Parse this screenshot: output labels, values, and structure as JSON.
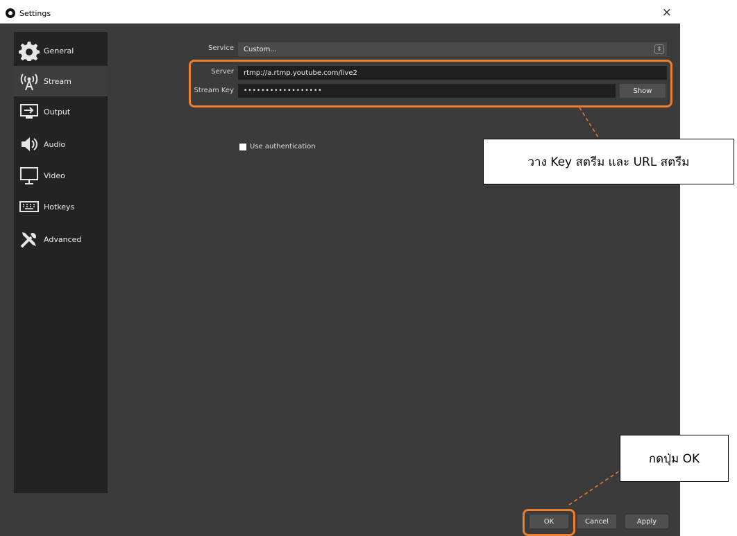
{
  "window": {
    "title": "Settings",
    "close_glyph": "×"
  },
  "sidebar": {
    "items": [
      {
        "label": "General",
        "icon": "gear-icon"
      },
      {
        "label": "Stream",
        "icon": "antenna-icon",
        "active": true
      },
      {
        "label": "Output",
        "icon": "output-icon"
      },
      {
        "label": "Audio",
        "icon": "speaker-icon"
      },
      {
        "label": "Video",
        "icon": "monitor-icon"
      },
      {
        "label": "Hotkeys",
        "icon": "keyboard-icon"
      },
      {
        "label": "Advanced",
        "icon": "tools-icon"
      }
    ]
  },
  "stream": {
    "service_label": "Service",
    "service_value": "Custom...",
    "server_label": "Server",
    "server_value": "rtmp://a.rtmp.youtube.com/live2",
    "key_label": "Stream Key",
    "key_value": "••••••••••••••••••",
    "show_button": "Show",
    "auth_label": "Use authentication",
    "auth_checked": false
  },
  "footer": {
    "ok": "OK",
    "cancel": "Cancel",
    "apply": "Apply"
  },
  "annotations": {
    "callout_key": "วาง Key สตรีม และ URL สตรีม",
    "callout_ok": "กดปุ่ม OK",
    "highlight_color": "#ef7d2e"
  }
}
